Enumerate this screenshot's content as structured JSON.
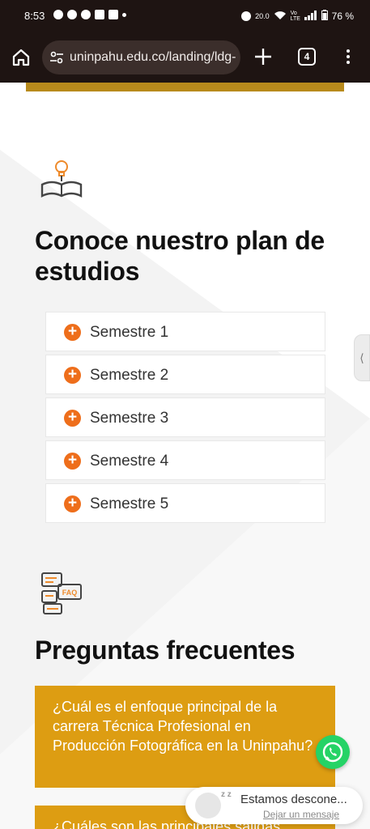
{
  "status_bar": {
    "time": "8:53",
    "notification_icons": [
      "snapchat-icon",
      "whatsapp-icon",
      "messenger-icon",
      "recycle-icon",
      "youtube-icon",
      "dot-icon"
    ],
    "speed": "20.0",
    "battery": "76 %",
    "network": "Vo LTE"
  },
  "browser": {
    "url": "uninpahu.edu.co/landing/ldg-",
    "tab_count": "4",
    "colors": {
      "toolbar_bg": "#1e1412",
      "urlbar_bg": "#3b2e2b"
    }
  },
  "plan": {
    "title": "Conoce nuestro plan de estudios",
    "semesters": [
      {
        "label": "Semestre 1"
      },
      {
        "label": "Semestre 2"
      },
      {
        "label": "Semestre 3"
      },
      {
        "label": "Semestre 4"
      },
      {
        "label": "Semestre 5"
      }
    ],
    "expand_symbol": "+",
    "accent": "#ee6e1b"
  },
  "side_handle": {
    "symbol": "⟨"
  },
  "faq": {
    "title": "Preguntas frecuentes",
    "badge_text": "FAQ",
    "questions": [
      {
        "text": "¿Cuál es el enfoque principal de la carrera Técnica Profesional en Producción Fotográfica en la Uninpahu?"
      },
      {
        "text": "¿Cuáles son las principales salidas"
      }
    ],
    "card_color": "#dd9d12"
  },
  "chat_widget": {
    "status": "Estamos descone...",
    "link": "Dejar un mensaje",
    "zz": "z z"
  }
}
